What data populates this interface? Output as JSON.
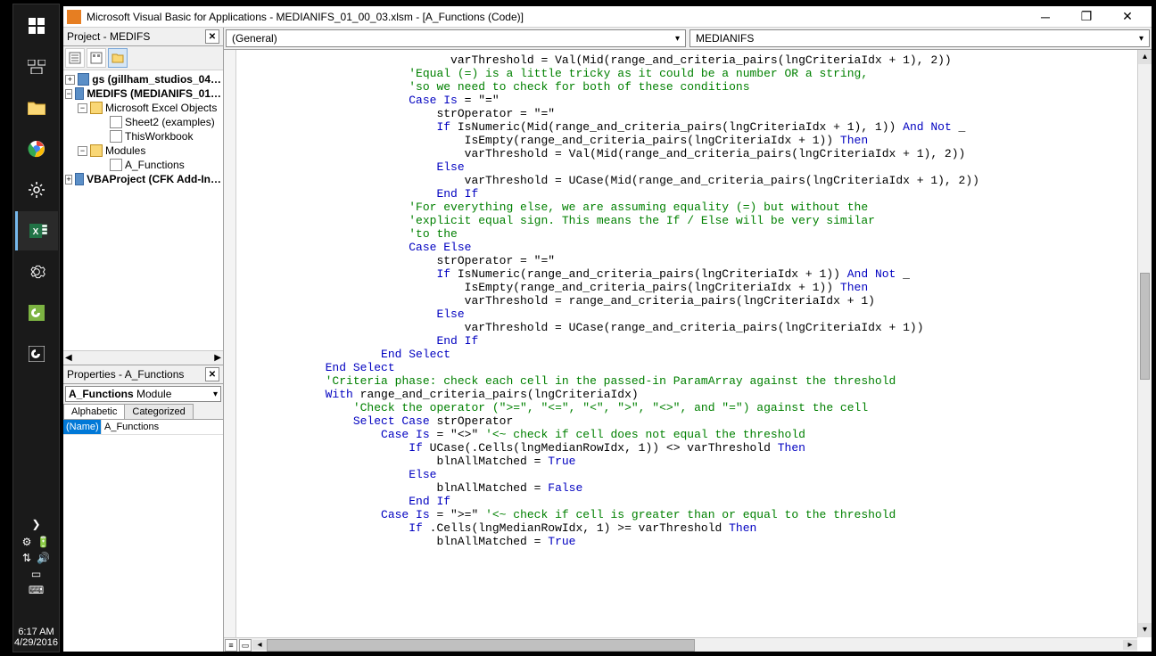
{
  "taskbar": {
    "clock_time": "6:17 AM",
    "clock_date": "4/29/2016"
  },
  "titlebar": {
    "text": "Microsoft Visual Basic for Applications - MEDIANIFS_01_00_03.xlsm - [A_Functions (Code)]"
  },
  "project_panel": {
    "title": "Project - MEDIFS",
    "items": {
      "p1": "gs (gillham_studios_04…",
      "p2": "MEDIFS (MEDIANIFS_01…",
      "excel_objects": "Microsoft Excel Objects",
      "sheet2": "Sheet2 (examples)",
      "thiswb": "ThisWorkbook",
      "modules": "Modules",
      "afunc": "A_Functions",
      "p3": "VBAProject (CFK Add-In…"
    }
  },
  "props_panel": {
    "title": "Properties - A_Functions",
    "combo": "A_Functions Module",
    "tabs": {
      "alpha": "Alphabetic",
      "cat": "Categorized"
    },
    "row_key": "(Name)",
    "row_val": "A_Functions"
  },
  "code_combos": {
    "left": "(General)",
    "right": "MEDIANIFS"
  },
  "code_lines": [
    {
      "indent": 30,
      "segs": [
        {
          "t": "varThreshold = Val(Mid(range_and_criteria_pairs(lngCriteriaIdx + 1), 2))"
        }
      ]
    },
    {
      "indent": 0,
      "segs": [
        {
          "t": ""
        }
      ]
    },
    {
      "indent": 24,
      "segs": [
        {
          "t": "'Equal (=) is a little tricky as it could be a number OR a string,",
          "c": "cm"
        }
      ]
    },
    {
      "indent": 24,
      "segs": [
        {
          "t": "'so we need to check for both of these conditions",
          "c": "cm"
        }
      ]
    },
    {
      "indent": 24,
      "segs": [
        {
          "t": "Case Is",
          "c": "kw"
        },
        {
          "t": " = \"=\""
        }
      ]
    },
    {
      "indent": 28,
      "segs": [
        {
          "t": "strOperator = \"=\""
        }
      ]
    },
    {
      "indent": 28,
      "segs": [
        {
          "t": "If",
          "c": "kw"
        },
        {
          "t": " IsNumeric(Mid(range_and_criteria_pairs(lngCriteriaIdx + 1), 1)) "
        },
        {
          "t": "And Not",
          "c": "kw"
        },
        {
          "t": " _"
        }
      ]
    },
    {
      "indent": 32,
      "segs": [
        {
          "t": "IsEmpty(range_and_criteria_pairs(lngCriteriaIdx + 1)) "
        },
        {
          "t": "Then",
          "c": "kw"
        }
      ]
    },
    {
      "indent": 32,
      "segs": [
        {
          "t": "varThreshold = Val(Mid(range_and_criteria_pairs(lngCriteriaIdx + 1), 2))"
        }
      ]
    },
    {
      "indent": 28,
      "segs": [
        {
          "t": "Else",
          "c": "kw"
        }
      ]
    },
    {
      "indent": 32,
      "segs": [
        {
          "t": "varThreshold = UCase(Mid(range_and_criteria_pairs(lngCriteriaIdx + 1), 2))"
        }
      ]
    },
    {
      "indent": 28,
      "segs": [
        {
          "t": "End If",
          "c": "kw"
        }
      ]
    },
    {
      "indent": 0,
      "segs": [
        {
          "t": ""
        }
      ]
    },
    {
      "indent": 24,
      "segs": [
        {
          "t": "'For everything else, we are assuming equality (=) but without the",
          "c": "cm"
        }
      ]
    },
    {
      "indent": 24,
      "segs": [
        {
          "t": "'explicit equal sign. This means the If / Else will be very similar",
          "c": "cm"
        }
      ]
    },
    {
      "indent": 24,
      "segs": [
        {
          "t": "'to the",
          "c": "cm"
        }
      ]
    },
    {
      "indent": 24,
      "segs": [
        {
          "t": "Case Else",
          "c": "kw"
        }
      ]
    },
    {
      "indent": 28,
      "segs": [
        {
          "t": "strOperator = \"=\""
        }
      ]
    },
    {
      "indent": 28,
      "segs": [
        {
          "t": "If",
          "c": "kw"
        },
        {
          "t": " IsNumeric(range_and_criteria_pairs(lngCriteriaIdx + 1)) "
        },
        {
          "t": "And Not",
          "c": "kw"
        },
        {
          "t": " _"
        }
      ]
    },
    {
      "indent": 32,
      "segs": [
        {
          "t": "IsEmpty(range_and_criteria_pairs(lngCriteriaIdx + 1)) "
        },
        {
          "t": "Then",
          "c": "kw"
        }
      ]
    },
    {
      "indent": 32,
      "segs": [
        {
          "t": "varThreshold = range_and_criteria_pairs(lngCriteriaIdx + 1)"
        }
      ]
    },
    {
      "indent": 28,
      "segs": [
        {
          "t": "Else",
          "c": "kw"
        }
      ]
    },
    {
      "indent": 32,
      "segs": [
        {
          "t": "varThreshold = UCase(range_and_criteria_pairs(lngCriteriaIdx + 1))"
        }
      ]
    },
    {
      "indent": 28,
      "segs": [
        {
          "t": "End If",
          "c": "kw"
        }
      ]
    },
    {
      "indent": 20,
      "segs": [
        {
          "t": "End Select",
          "c": "kw"
        }
      ]
    },
    {
      "indent": 0,
      "segs": [
        {
          "t": ""
        }
      ]
    },
    {
      "indent": 12,
      "segs": [
        {
          "t": "End Select",
          "c": "kw"
        }
      ]
    },
    {
      "indent": 0,
      "segs": [
        {
          "t": ""
        }
      ]
    },
    {
      "indent": 12,
      "segs": [
        {
          "t": "'Criteria phase: check each cell in the passed-in ParamArray against the threshold",
          "c": "cm"
        }
      ]
    },
    {
      "indent": 12,
      "segs": [
        {
          "t": "With",
          "c": "kw"
        },
        {
          "t": " range_and_criteria_pairs(lngCriteriaIdx)"
        }
      ]
    },
    {
      "indent": 0,
      "segs": [
        {
          "t": ""
        }
      ]
    },
    {
      "indent": 16,
      "segs": [
        {
          "t": "'Check the operator (\">=\", \"<=\", \"<\", \">\", \"<>\", and \"=\") against the cell",
          "c": "cm"
        }
      ]
    },
    {
      "indent": 16,
      "segs": [
        {
          "t": "Select Case",
          "c": "kw"
        },
        {
          "t": " strOperator"
        }
      ]
    },
    {
      "indent": 20,
      "segs": [
        {
          "t": "Case Is",
          "c": "kw"
        },
        {
          "t": " = \"<>\" "
        },
        {
          "t": "'<~ check if cell does not equal the threshold",
          "c": "cm"
        }
      ]
    },
    {
      "indent": 24,
      "segs": [
        {
          "t": "If",
          "c": "kw"
        },
        {
          "t": " UCase(.Cells(lngMedianRowIdx, 1)) <> varThreshold "
        },
        {
          "t": "Then",
          "c": "kw"
        }
      ]
    },
    {
      "indent": 28,
      "segs": [
        {
          "t": "blnAllMatched = "
        },
        {
          "t": "True",
          "c": "kw"
        }
      ]
    },
    {
      "indent": 24,
      "segs": [
        {
          "t": "Else",
          "c": "kw"
        }
      ]
    },
    {
      "indent": 28,
      "segs": [
        {
          "t": "blnAllMatched = "
        },
        {
          "t": "False",
          "c": "kw"
        }
      ]
    },
    {
      "indent": 24,
      "segs": [
        {
          "t": "End If",
          "c": "kw"
        }
      ]
    },
    {
      "indent": 20,
      "segs": [
        {
          "t": "Case Is",
          "c": "kw"
        },
        {
          "t": " = \">=\" "
        },
        {
          "t": "'<~ check if cell is greater than or equal to the threshold",
          "c": "cm"
        }
      ]
    },
    {
      "indent": 24,
      "segs": [
        {
          "t": "If",
          "c": "kw"
        },
        {
          "t": " .Cells(lngMedianRowIdx, 1) >= varThreshold "
        },
        {
          "t": "Then",
          "c": "kw"
        }
      ]
    },
    {
      "indent": 28,
      "segs": [
        {
          "t": "blnAllMatched = "
        },
        {
          "t": "True",
          "c": "kw"
        }
      ]
    }
  ]
}
